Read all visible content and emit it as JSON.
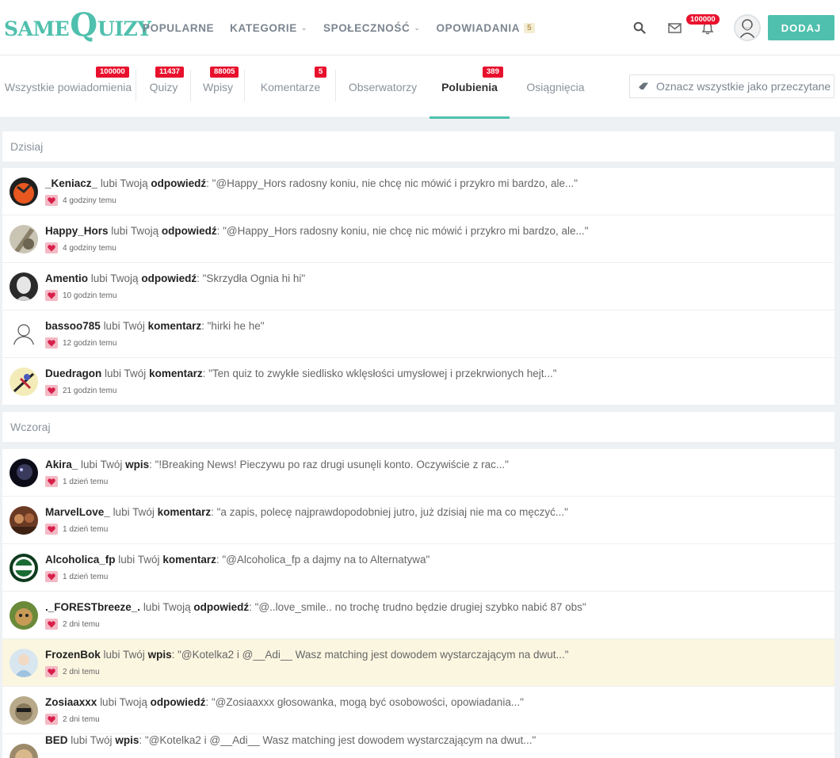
{
  "logo": {
    "part1": "SAME",
    "part2": "Q",
    "part3": "UIZY"
  },
  "nav": {
    "popularne": "POPULARNE",
    "kategorie": "KATEGORIE",
    "spolecznosc": "SPOŁECZNOŚĆ",
    "opowiadania": "OPOWIADANIA",
    "opowiadania_count": "5",
    "bell_badge": "100000",
    "add_label": "DODAJ"
  },
  "tabs": [
    {
      "label": "Wszystkie powiadomienia",
      "badge": "100000"
    },
    {
      "label": "Quizy",
      "badge": "11437"
    },
    {
      "label": "Wpisy",
      "badge": "88005"
    },
    {
      "label": "Komentarze",
      "badge": "5"
    },
    {
      "label": "Obserwatorzy",
      "badge": ""
    },
    {
      "label": "Polubienia",
      "badge": "389"
    },
    {
      "label": "Osiągnięcia",
      "badge": ""
    }
  ],
  "mark_all_label": "Oznacz wszystkie jako przeczytane",
  "sections": [
    {
      "title": "Dzisiaj",
      "items": [
        {
          "user": "_Keniacz_",
          "verb": "lubi Twoją",
          "object": "odpowiedź",
          "quote": ": \"@Happy_Hors radosny koniu, nie chcę nic mówić i przykro mi bardzo, ale...\"",
          "time": "4 godziny temu"
        },
        {
          "user": "Happy_Hors",
          "verb": "lubi Twoją",
          "object": "odpowiedź",
          "quote": ": \"@Happy_Hors radosny koniu, nie chcę nic mówić i przykro mi bardzo, ale...\"",
          "time": "4 godziny temu"
        },
        {
          "user": "Amentio",
          "verb": "lubi Twoją",
          "object": "odpowiedź",
          "quote": ": \"Skrzydła Ognia hi hi\"",
          "time": "10 godzin temu"
        },
        {
          "user": "bassoo785",
          "verb": "lubi Twój",
          "object": "komentarz",
          "quote": ": \"hirki he he\"",
          "time": "12 godzin temu"
        },
        {
          "user": "Duedragon",
          "verb": "lubi Twój",
          "object": "komentarz",
          "quote": ": \"Ten quiz to zwykłe siedlisko wklęsłości umysłowej i przekrwionych hejt...\"",
          "time": "21 godzin temu"
        }
      ]
    },
    {
      "title": "Wczoraj",
      "items": [
        {
          "user": "Akira_",
          "verb": "lubi Twój",
          "object": "wpis",
          "quote": ": \"!Breaking News! Pieczywu po raz drugi usunęli konto. Oczywiście z rac...\"",
          "time": "1 dzień temu"
        },
        {
          "user": "MarvelLove_",
          "verb": "lubi Twój",
          "object": "komentarz",
          "quote": ": \"a zapis, polecę najprawdopodobniej jutro, już dzisiaj nie ma co męczyć...\"",
          "time": "1 dzień temu"
        },
        {
          "user": "Alcoholica_fp",
          "verb": "lubi Twój",
          "object": "komentarz",
          "quote": ": \"@Alcoholica_fp a dajmy na to Alternatywa\"",
          "time": "1 dzień temu"
        },
        {
          "user": "._FORESTbreeze_.",
          "verb": "lubi Twoją",
          "object": "odpowiedź",
          "quote": ": \"@..love_smile.. no trochę trudno będzie drugiej szybko nabić 87 obs\"",
          "time": "2 dni temu"
        },
        {
          "user": "FrozenBok",
          "verb": "lubi Twój",
          "object": "wpis",
          "quote": ": \"@Kotelka2 i @__Adi__ Wasz matching jest dowodem wystarczającym na dwut...\"",
          "time": "2 dni temu"
        },
        {
          "user": "Zosiaaxxx",
          "verb": "lubi Twoją",
          "object": "odpowiedź",
          "quote": ": \"@Zosiaaxxx głosowanka, mogą być osobowości, opowiadania...\"",
          "time": "2 dni temu"
        },
        {
          "user": "BED",
          "verb": "lubi Twój",
          "object": "wpis",
          "quote": ": \"@Kotelka2 i @__Adi__ Wasz matching jest dowodem wystarczającym na dwut...\"",
          "time": ""
        }
      ]
    }
  ],
  "colors": {
    "brand": "#4fc0ad",
    "badge": "#e8112d",
    "highlight": "#fbf6e0",
    "heart": "#d6204a"
  }
}
